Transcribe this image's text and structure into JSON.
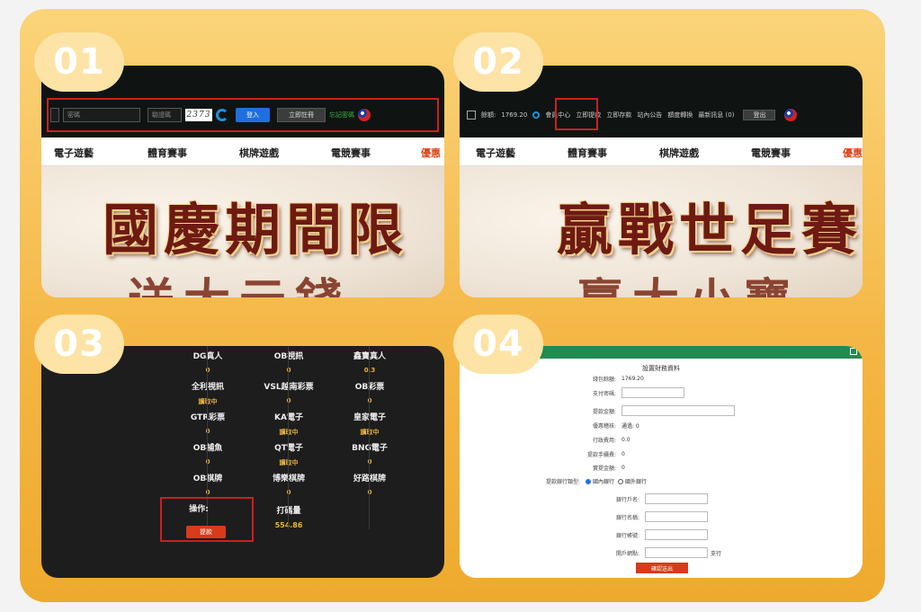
{
  "steps": [
    {
      "number": "01"
    },
    {
      "number": "02"
    },
    {
      "number": "03"
    },
    {
      "number": "04"
    }
  ],
  "login": {
    "password_placeholder": "密碼",
    "captcha_placeholder": "驗證碼",
    "captcha_value": "2373",
    "login_button": "登入",
    "register_button": "立即註冊",
    "forgot_link": "忘記密碼"
  },
  "nav": {
    "items": [
      "電子遊藝",
      "體育賽事",
      "棋牌遊戲",
      "電競賽事",
      "優惠"
    ]
  },
  "banner1": {
    "line1": "國慶期間限",
    "line2": "送大元錢"
  },
  "banner2": {
    "line1": "贏戰世足賽",
    "line2": "贏大小寶"
  },
  "account": {
    "balance_label": "餘額:",
    "balance_value": "1769.20",
    "member_center": "會員中心",
    "withdraw_now": "立即提款",
    "deposit_now": "立即存款",
    "announcement": "站內公告",
    "transfer": "額度轉換",
    "messages": "最新訊息 (0)",
    "logout": "登出"
  },
  "wallets": [
    {
      "name": "DG真人",
      "value": "0"
    },
    {
      "name": "OB視訊",
      "value": "0"
    },
    {
      "name": "鑫寶真人",
      "value": "0.3"
    },
    {
      "name": "全利視訊",
      "value": "讀取中"
    },
    {
      "name": "VSL越南彩票",
      "value": "0"
    },
    {
      "name": "OB彩票",
      "value": "0"
    },
    {
      "name": "GTR彩票",
      "value": "0"
    },
    {
      "name": "KA電子",
      "value": "讀取中"
    },
    {
      "name": "皇家電子",
      "value": "讀取中"
    },
    {
      "name": "OB捕魚",
      "value": "0"
    },
    {
      "name": "QT電子",
      "value": "讀取中"
    },
    {
      "name": "BNG電子",
      "value": "0"
    },
    {
      "name": "OB棋牌",
      "value": "0"
    },
    {
      "name": "博樂棋牌",
      "value": "0"
    },
    {
      "name": "好路棋牌",
      "value": "0"
    },
    {
      "name": "打碼量",
      "value": "554.86"
    }
  ],
  "operation": {
    "label": "操作:",
    "button": "提款"
  },
  "withdraw_form": {
    "title": "設置財務資料",
    "rows": [
      {
        "label": "錢包餘額:",
        "value": "1769.20"
      },
      {
        "label": "支付密碼:",
        "value": ""
      },
      {
        "label": "提款金額:",
        "value": ""
      },
      {
        "label": "優惠稽核:",
        "value": "通過: 0"
      },
      {
        "label": "行政費用:",
        "value": "0.0"
      },
      {
        "label": "提款手續費:",
        "value": "0"
      },
      {
        "label": "實提金額:",
        "value": "0"
      }
    ],
    "bank_type_label": "提款銀行類型:",
    "bank_type_options": [
      "國內銀行",
      "國外銀行"
    ],
    "bank_fields": [
      "銀行戶名:",
      "銀行名稱:",
      "銀行帳號:",
      "開戶網點:"
    ],
    "branch_suffix": "支行",
    "submit": "確認送出"
  },
  "colors": {
    "frame": "#f4b542",
    "badge": "#fde3a5",
    "highlight": "#cc1f1f",
    "primary_button": "#1f6fe0",
    "red_button": "#d83a1a",
    "gold_text": "#e8b338"
  }
}
